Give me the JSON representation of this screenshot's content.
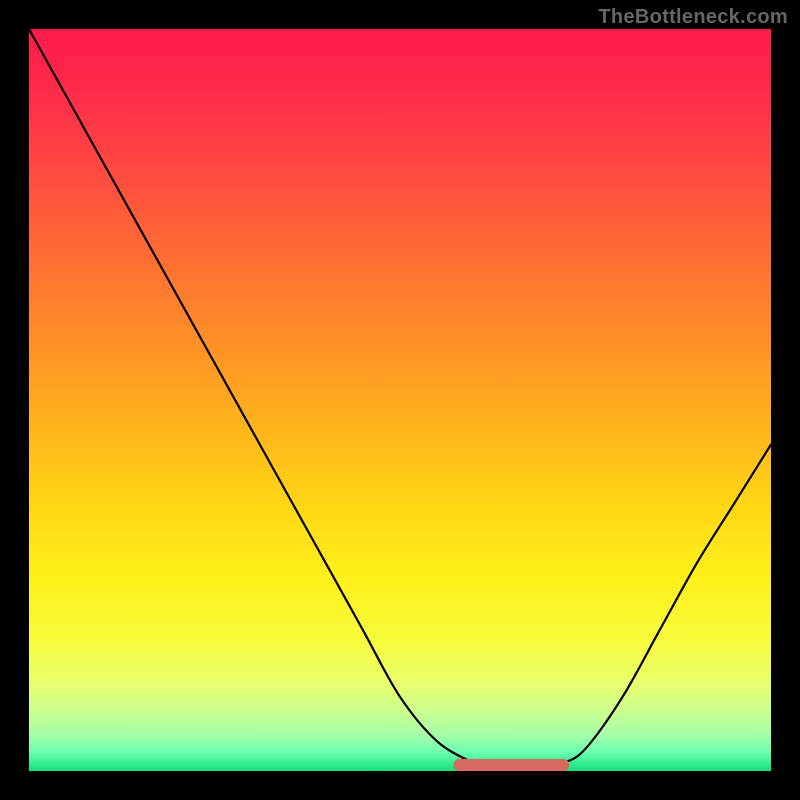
{
  "brand": {
    "text": "TheBottleneck.com"
  },
  "colors": {
    "curve": "#000000",
    "accent": "#d76a60",
    "frame": "#000000"
  },
  "chart_data": {
    "type": "line",
    "title": "",
    "xlabel": "",
    "ylabel": "",
    "xlim": [
      0,
      100
    ],
    "ylim": [
      0,
      100
    ],
    "curve_y_for_x": [
      [
        0,
        100
      ],
      [
        5,
        91
      ],
      [
        10,
        82
      ],
      [
        15,
        73
      ],
      [
        20,
        64
      ],
      [
        25,
        55
      ],
      [
        30,
        46
      ],
      [
        35,
        37
      ],
      [
        40,
        28
      ],
      [
        45,
        19
      ],
      [
        50,
        10
      ],
      [
        55,
        4
      ],
      [
        60,
        1
      ],
      [
        62,
        0
      ],
      [
        65,
        0
      ],
      [
        68,
        0
      ],
      [
        70,
        0
      ],
      [
        72,
        1
      ],
      [
        75,
        3
      ],
      [
        80,
        10
      ],
      [
        85,
        19
      ],
      [
        90,
        28
      ],
      [
        95,
        36
      ],
      [
        100,
        44
      ]
    ],
    "flat_bottom_range_x": [
      58,
      72
    ],
    "notes": "Large V-shaped curve descending from top-left, reaching a flat minimum near x≈58–72 at y≈0, then rising to the right. The minimum segment is highlighted."
  }
}
